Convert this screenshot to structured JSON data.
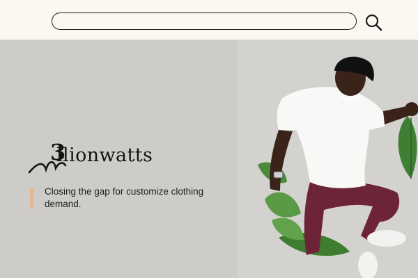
{
  "search": {
    "value": "",
    "placeholder": ""
  },
  "icons": {
    "search": "search-icon",
    "logo_mark": "signature-swoosh"
  },
  "brand": {
    "three": "3",
    "name": "llionwatts"
  },
  "hero": {
    "tagline": "Closing the gap for customize clothing demand."
  },
  "colors": {
    "header_bg": "#fbf7f1",
    "hero_bg": "#cdccc9",
    "accent": "#e0b98f",
    "shirt": "#f7f7f7",
    "pants": "#6e2438",
    "leaf": "#4f8f3c"
  }
}
